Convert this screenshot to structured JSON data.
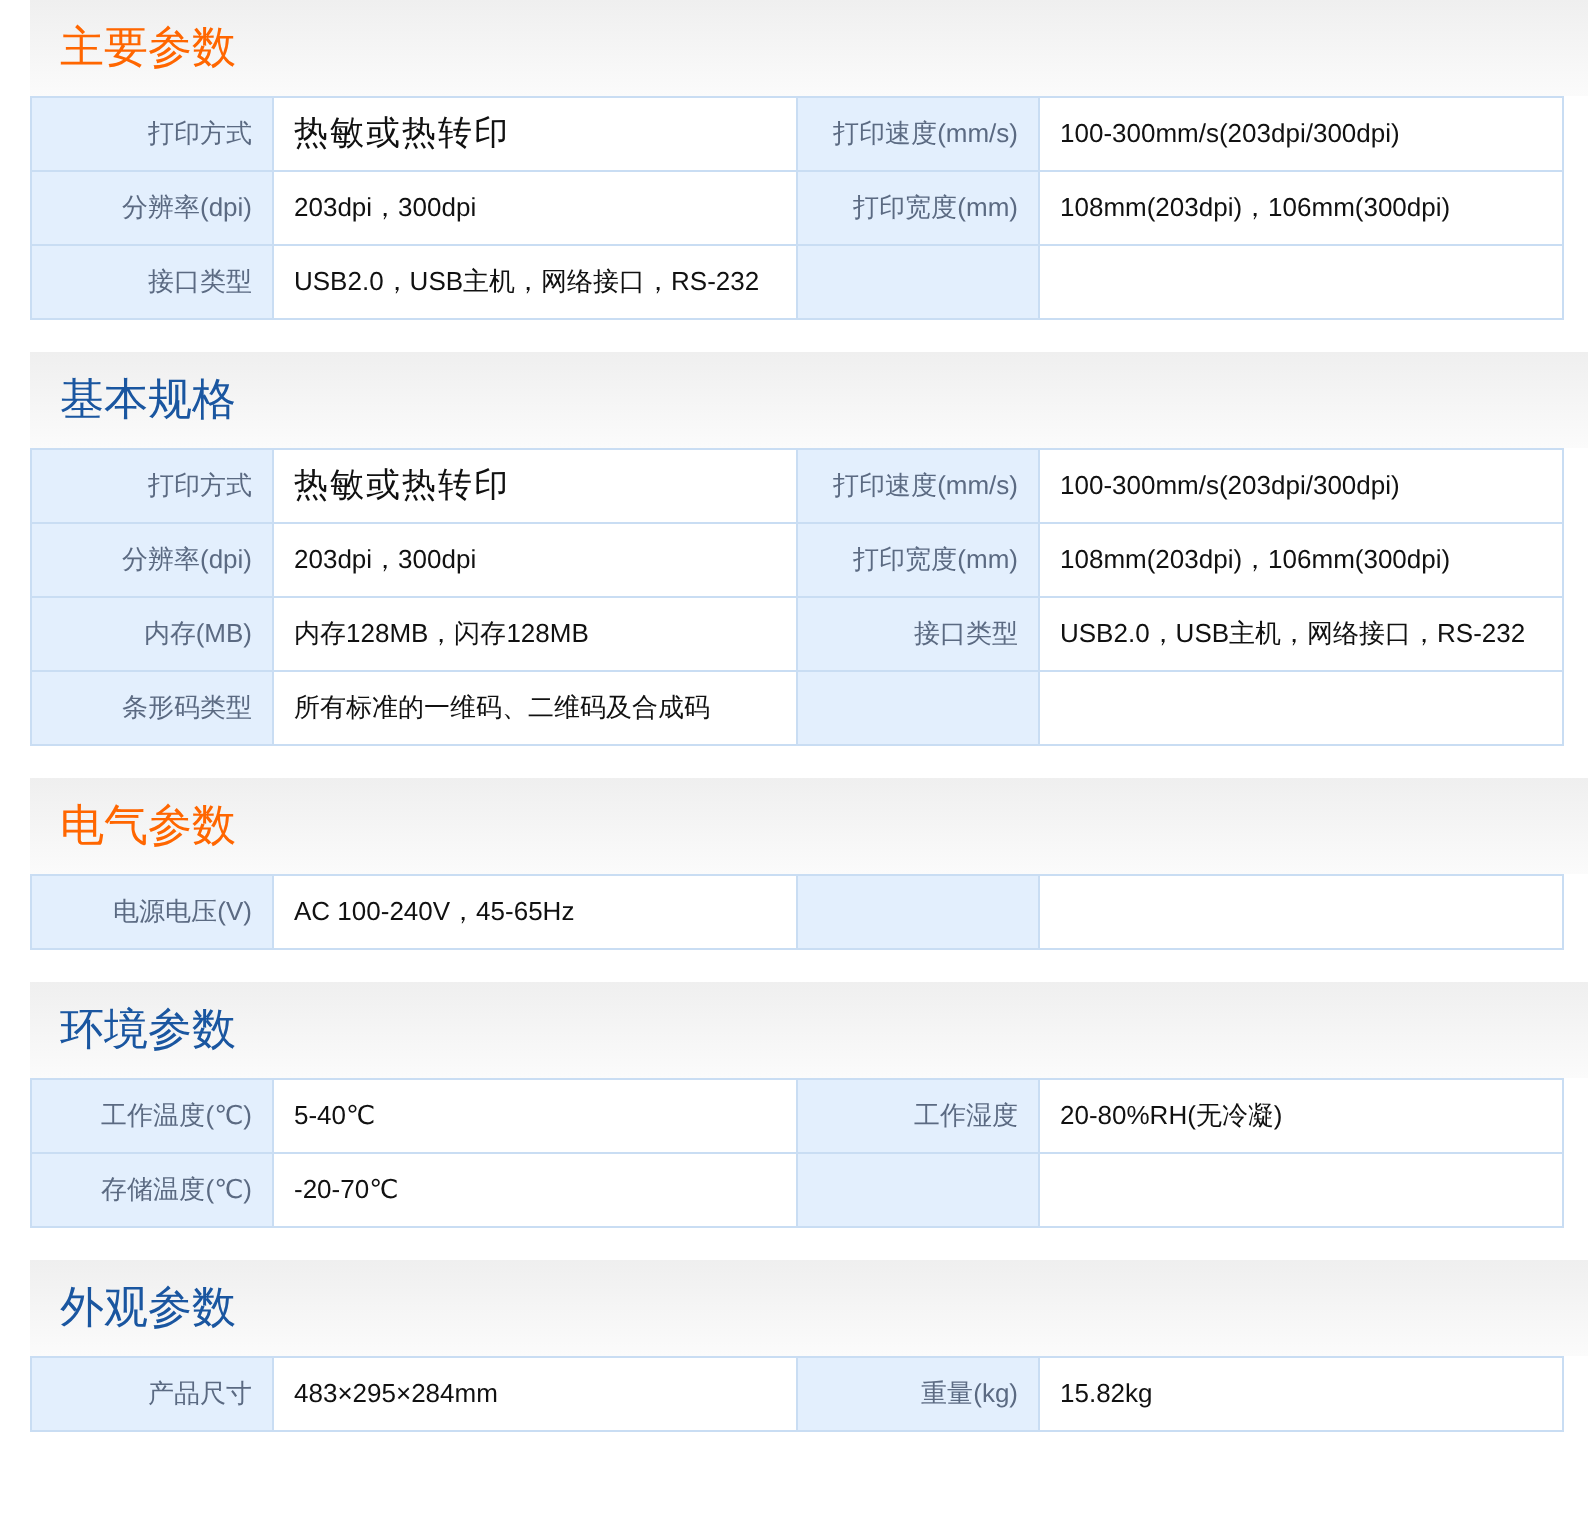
{
  "sections": [
    {
      "title": "主要参数",
      "color": "#ff6600",
      "rows": [
        [
          {
            "label": "打印方式",
            "value": "热敏或热转印",
            "large": true
          },
          {
            "label": "打印速度(mm/s)",
            "value": "100-300mm/s(203dpi/300dpi)",
            "large": false
          }
        ],
        [
          {
            "label": "分辨率(dpi)",
            "value": "203dpi，300dpi",
            "large": false
          },
          {
            "label": "打印宽度(mm)",
            "value": "108mm(203dpi)，106mm(300dpi)",
            "large": false
          }
        ],
        [
          {
            "label": "接口类型",
            "value": "USB2.0，USB主机，网络接口，RS-232",
            "large": false
          }
        ]
      ]
    },
    {
      "title": "基本规格",
      "color": "#1a56a0",
      "rows": [
        [
          {
            "label": "打印方式",
            "value": "热敏或热转印",
            "large": true
          },
          {
            "label": "打印速度(mm/s)",
            "value": "100-300mm/s(203dpi/300dpi)",
            "large": false
          }
        ],
        [
          {
            "label": "分辨率(dpi)",
            "value": "203dpi，300dpi",
            "large": false
          },
          {
            "label": "打印宽度(mm)",
            "value": "108mm(203dpi)，106mm(300dpi)",
            "large": false
          }
        ],
        [
          {
            "label": "内存(MB)",
            "value": "内存128MB，闪存128MB",
            "large": false
          },
          {
            "label": "接口类型",
            "value": "USB2.0，USB主机，网络接口，RS-232",
            "large": false
          }
        ],
        [
          {
            "label": "条形码类型",
            "value": "所有标准的一维码、二维码及合成码",
            "large": false
          }
        ]
      ]
    },
    {
      "title": "电气参数",
      "color": "#ff6600",
      "rows": [
        [
          {
            "label": "电源电压(V)",
            "value": "AC 100-240V，45-65Hz",
            "large": false
          }
        ]
      ]
    },
    {
      "title": "环境参数",
      "color": "#1a56a0",
      "rows": [
        [
          {
            "label": "工作温度(℃)",
            "value": "5-40℃",
            "large": false
          },
          {
            "label": "工作湿度",
            "value": "20-80%RH(无冷凝)",
            "large": false
          }
        ],
        [
          {
            "label": "存储温度(℃)",
            "value": "-20-70℃",
            "large": false
          }
        ]
      ]
    },
    {
      "title": "外观参数",
      "color": "#1a56a0",
      "rows": [
        [
          {
            "label": "产品尺寸",
            "value": "483×295×284mm",
            "large": false
          },
          {
            "label": "重量(kg)",
            "value": "15.82kg",
            "large": false
          }
        ]
      ]
    }
  ]
}
